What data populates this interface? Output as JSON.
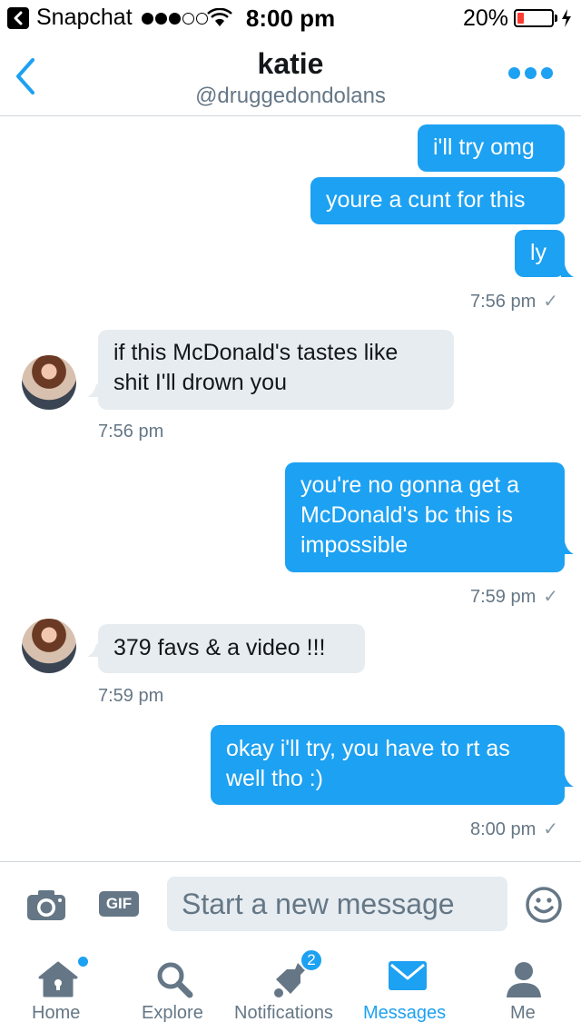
{
  "status_bar": {
    "app": "Snapchat",
    "time": "8:00 pm",
    "battery_percent": "20%",
    "battery_level": 0.2,
    "signal_bars_filled": 3,
    "signal_bars_total": 5
  },
  "header": {
    "title": "katie",
    "handle": "@druggedondolans"
  },
  "messages": [
    {
      "direction": "sent",
      "text": "i'll try omg"
    },
    {
      "direction": "sent",
      "text": "youre a cunt for this"
    },
    {
      "direction": "sent",
      "text": "ly"
    },
    {
      "direction": "timestamp-sent",
      "text": "7:56 pm",
      "read": "✓"
    },
    {
      "direction": "received",
      "text": "if this McDonald's tastes like shit I'll drown you"
    },
    {
      "direction": "timestamp-received",
      "text": "7:56 pm"
    },
    {
      "direction": "sent",
      "text": "you're no gonna get a McDonald's bc this is impossible"
    },
    {
      "direction": "timestamp-sent",
      "text": "7:59 pm",
      "read": "✓"
    },
    {
      "direction": "received",
      "text": "379 favs & a video !!!"
    },
    {
      "direction": "timestamp-received",
      "text": "7:59 pm"
    },
    {
      "direction": "sent",
      "text": "okay i'll try, you have to rt as well tho :)"
    },
    {
      "direction": "timestamp-sent",
      "text": "8:00 pm",
      "read": "✓"
    }
  ],
  "composer": {
    "gif_label": "GIF",
    "placeholder": "Start a new message"
  },
  "tabs": [
    {
      "label": "Home",
      "icon": "home-icon",
      "has_dot": true
    },
    {
      "label": "Explore",
      "icon": "search-icon"
    },
    {
      "label": "Notifications",
      "icon": "bell-icon",
      "badge": "2"
    },
    {
      "label": "Messages",
      "icon": "envelope-icon",
      "active": true
    },
    {
      "label": "Me",
      "icon": "person-icon"
    }
  ],
  "colors": {
    "accent": "#1da1f2",
    "incoming_bubble": "#e6ecf0",
    "secondary_text": "#657786",
    "battery_low": "#ff3b30"
  }
}
